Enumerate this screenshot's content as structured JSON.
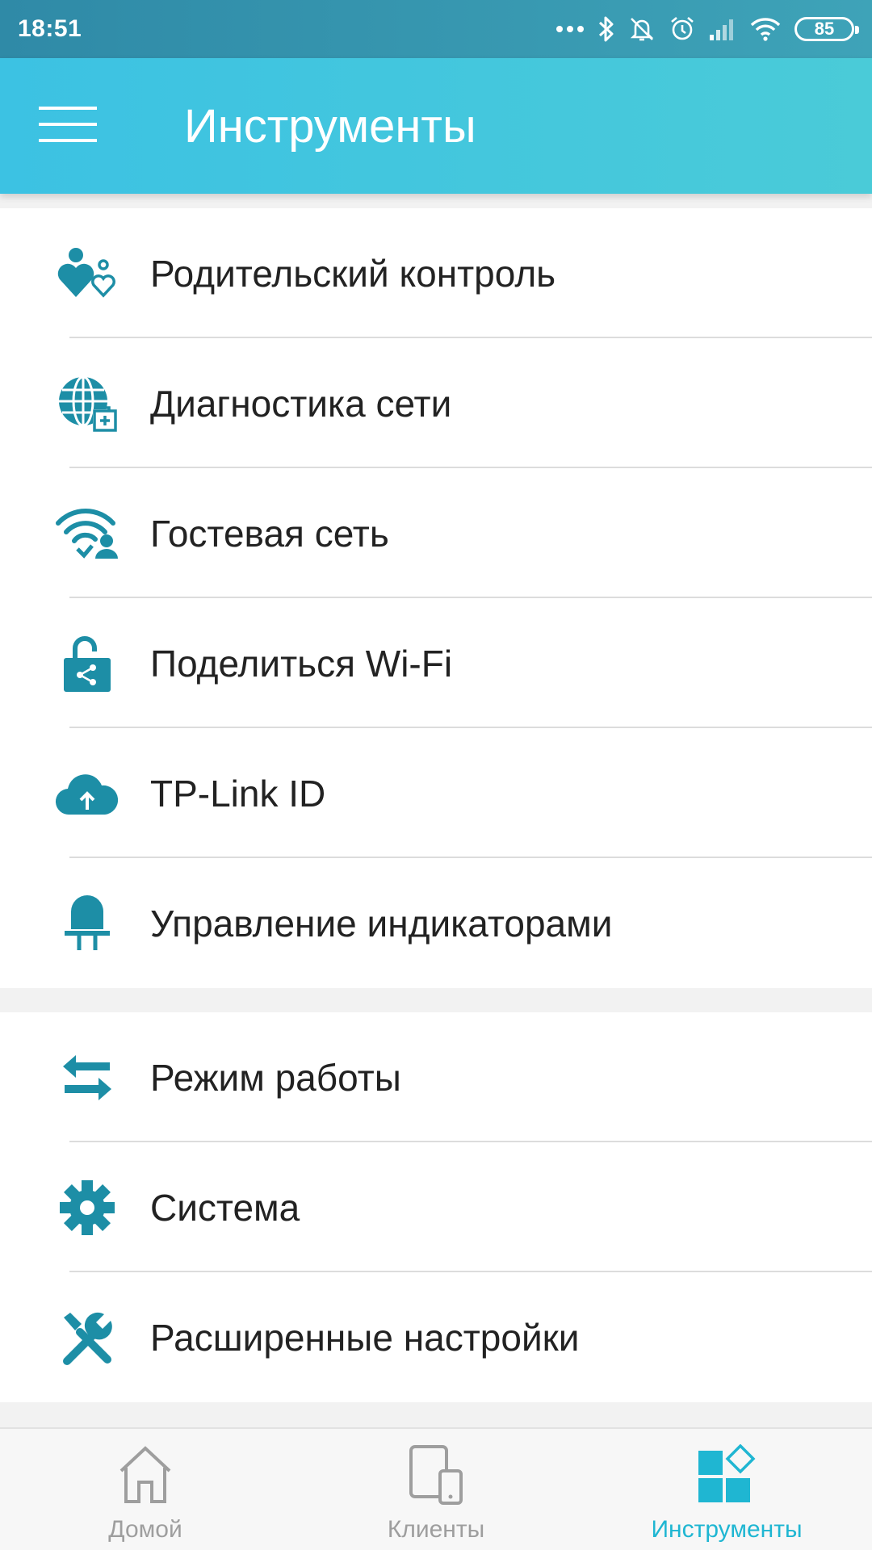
{
  "status_bar": {
    "time": "18:51",
    "battery": "85",
    "icons": [
      "more-dots-icon",
      "bluetooth-icon",
      "mute-icon",
      "alarm-icon",
      "signal-icon",
      "wifi-icon",
      "battery-icon"
    ]
  },
  "app_bar": {
    "title": "Инструменты",
    "menu_icon": "hamburger-menu-icon"
  },
  "groups": [
    {
      "items": [
        {
          "label": "Родительский контроль",
          "icon": "parental-control-icon"
        },
        {
          "label": "Диагностика сети",
          "icon": "network-diagnostics-icon"
        },
        {
          "label": "Гостевая сеть",
          "icon": "guest-network-icon"
        },
        {
          "label": "Поделиться Wi-Fi",
          "icon": "share-wifi-icon"
        },
        {
          "label": "TP-Link ID",
          "icon": "cloud-icon"
        },
        {
          "label": "Управление индикаторами",
          "icon": "led-indicator-icon"
        }
      ]
    },
    {
      "items": [
        {
          "label": "Режим работы",
          "icon": "operation-mode-icon"
        },
        {
          "label": "Система",
          "icon": "gear-icon"
        },
        {
          "label": "Расширенные настройки",
          "icon": "tools-icon"
        }
      ]
    }
  ],
  "bottom_nav": {
    "items": [
      {
        "label": "Домой",
        "icon": "home-icon",
        "active": false
      },
      {
        "label": "Клиенты",
        "icon": "devices-icon",
        "active": false
      },
      {
        "label": "Инструменты",
        "icon": "tools-grid-icon",
        "active": true
      }
    ]
  },
  "colors": {
    "accent": "#1fb6d2",
    "icon": "#1d8ea6",
    "app_bar": "#3cc2e3",
    "status_bar": "#2f8aa7",
    "inactive_nav": "#9e9e9e"
  }
}
